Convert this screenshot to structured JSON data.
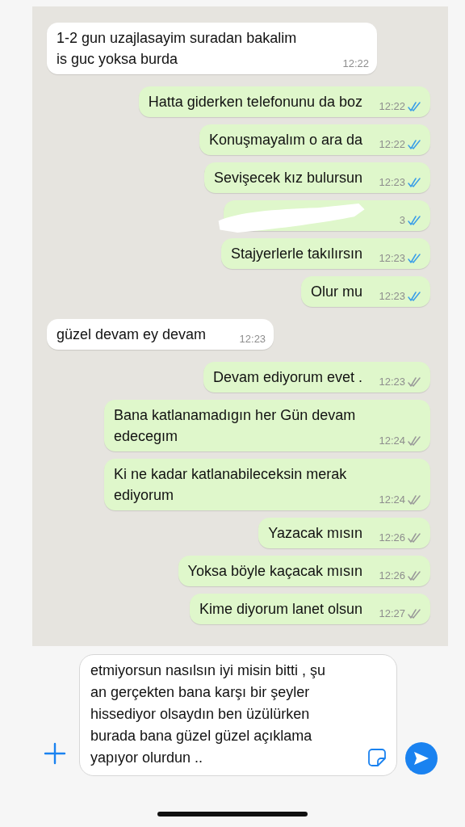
{
  "messages": [
    {
      "kind": "incoming",
      "text": "1-2 gun uzajlasayim suradan bakalim is guc yoksa burda",
      "time": "12:22"
    },
    {
      "kind": "outgoing",
      "text": "Hatta giderken telefonunu da boz",
      "time": "12:22",
      "read": true
    },
    {
      "kind": "outgoing",
      "text": "Konuşmayalım o ara da",
      "time": "12:22",
      "read": true
    },
    {
      "kind": "outgoing",
      "text": "Sevişecek kız bulursun",
      "time": "12:23",
      "read": true
    },
    {
      "kind": "redacted",
      "time": "3",
      "read": true
    },
    {
      "kind": "outgoing",
      "text": "Stajyerlerle takılırsın",
      "time": "12:23",
      "read": true
    },
    {
      "kind": "outgoing",
      "text": "Olur mu",
      "time": "12:23",
      "read": true
    },
    {
      "kind": "incoming",
      "text": "güzel devam ey devam",
      "time": "12:23"
    },
    {
      "kind": "outgoing",
      "text": "Devam ediyorum evet .",
      "time": "12:23",
      "read": false
    },
    {
      "kind": "outgoing",
      "text": "Bana katlanamadıgın her Gün devam edecegım",
      "time": "12:24",
      "read": false
    },
    {
      "kind": "outgoing",
      "text": "Ki ne kadar katlanabileceksin merak ediyorum",
      "time": "12:24",
      "read": false
    },
    {
      "kind": "outgoing",
      "text": "Yazacak mısın",
      "time": "12:26",
      "read": false
    },
    {
      "kind": "outgoing",
      "text": "Yoksa böyle kaçacak mısın",
      "time": "12:26",
      "read": false
    },
    {
      "kind": "outgoing",
      "text": "Kime diyorum lanet olsun",
      "time": "12:27",
      "read": false
    }
  ],
  "composer": {
    "value": "etmiyorsun nasılsın iyi misin bitti , şu an gerçekten bana karşı bir şeyler hissediyor olsaydın ben üzülürken burada bana güzel güzel açıklama yapıyor olurdun .."
  }
}
